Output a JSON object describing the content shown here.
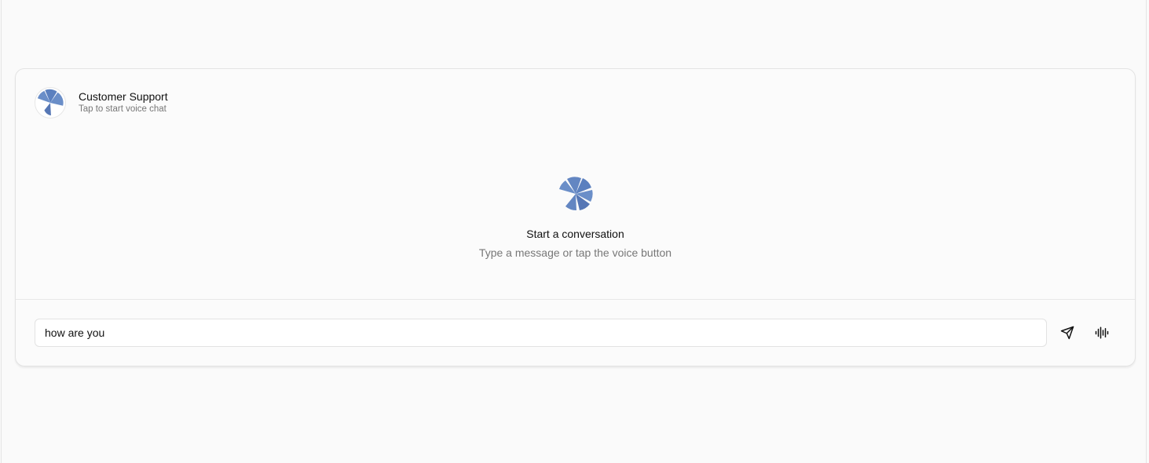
{
  "header": {
    "title": "Customer Support",
    "subtitle": "Tap to start voice chat",
    "avatar_icon": "orb-logo-icon"
  },
  "empty_state": {
    "icon": "orb-logo-icon",
    "title": "Start a conversation",
    "subtitle": "Type a message or tap the voice button"
  },
  "composer": {
    "value": "how are you",
    "send_icon": "send-icon",
    "voice_icon": "voice-waveform-icon"
  },
  "colors": {
    "accent": "#6a8ec8",
    "accent_dark": "#5677b5"
  }
}
